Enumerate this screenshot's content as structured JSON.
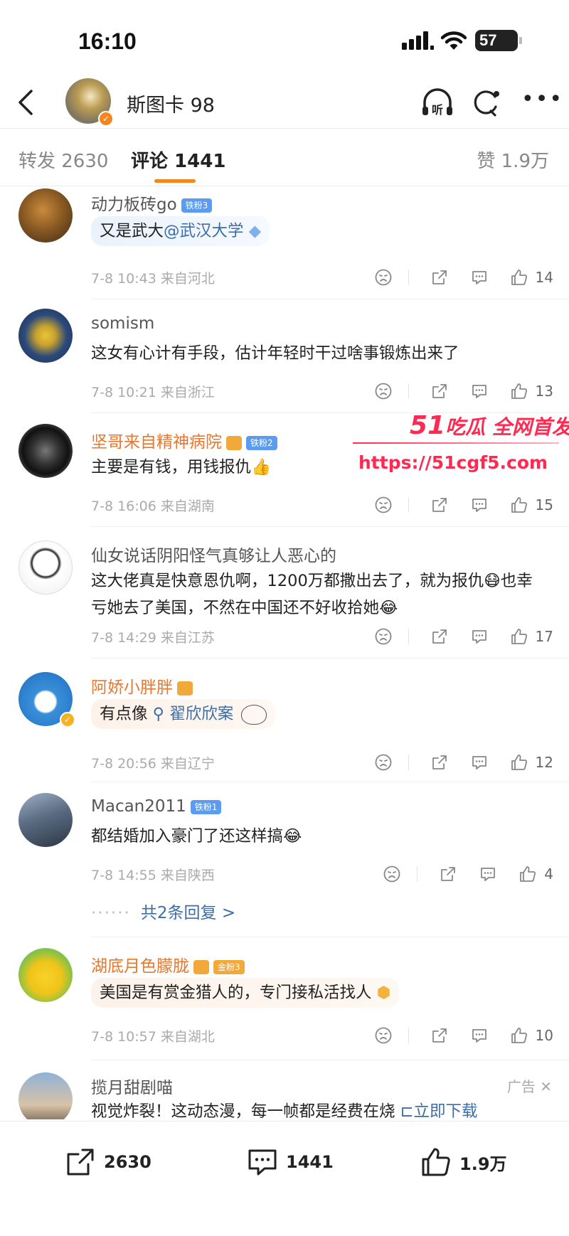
{
  "status_bar": {
    "time": "16:10",
    "battery": "57"
  },
  "header": {
    "username": "斯图卡 98"
  },
  "tabs": {
    "repost": "转发 2630",
    "comments": "评论 1441",
    "likes": "赞 1.9万"
  },
  "comments": [
    {
      "name": "动力板砖go",
      "badge": "铁粉3",
      "text_before": "又是武大",
      "mention": "@武汉大学",
      "time": "7-8 10:43 来自河北",
      "likes": "14"
    },
    {
      "name": "somism",
      "text": "这女有心计有手段，估计年轻时干过啥事锻炼出来了",
      "time": "7-8 10:21 来自浙江",
      "likes": "13"
    },
    {
      "name": "坚哥来自精神病院",
      "badge": "铁粉2",
      "text": "主要是有钱，用钱报仇👍",
      "time": "7-8 16:06 来自湖南",
      "likes": "15"
    },
    {
      "name": "仙女说话阴阳怪气真够让人恶心的",
      "text": "这大佬真是快意恩仇啊，1200万都撒出去了，就为报仇😷也幸亏她去了美国，不然在中国还不好收拾她😂",
      "time": "7-8 14:29 来自江苏",
      "likes": "17"
    },
    {
      "name": "阿娇小胖胖",
      "text_before": "有点像",
      "search_link": "翟欣欣案",
      "time": "7-8 20:56 来自辽宁",
      "likes": "12"
    },
    {
      "name": "Macan2011",
      "badge": "铁粉1",
      "text": "都结婚加入豪门了还这样搞😂",
      "time": "7-8 14:55 来自陕西",
      "likes": "4",
      "replies": "共2条回复 >"
    },
    {
      "name": "湖底月色朦胧",
      "badge": "金粉3",
      "text": "美国是有赏金猎人的，专门接私活找人",
      "time": "7-8 10:57 来自湖北",
      "likes": "10"
    },
    {
      "name": "揽月甜剧喵",
      "text_before": "视觉炸裂！这动态漫，每一帧都是经费在烧",
      "cta": "立即下载",
      "ad": "广告"
    }
  ],
  "bottom_bar": {
    "repost": "2630",
    "comment": "1441",
    "like": "1.9万"
  },
  "watermark": {
    "title_num": "51",
    "title_text": "吃瓜 全网首发",
    "url": "https://51cgf5.com"
  },
  "colors": {
    "accent": "#f5861f",
    "link": "#3c6ea8",
    "orange_name": "#e8772e",
    "watermark": "#ff2a52"
  }
}
